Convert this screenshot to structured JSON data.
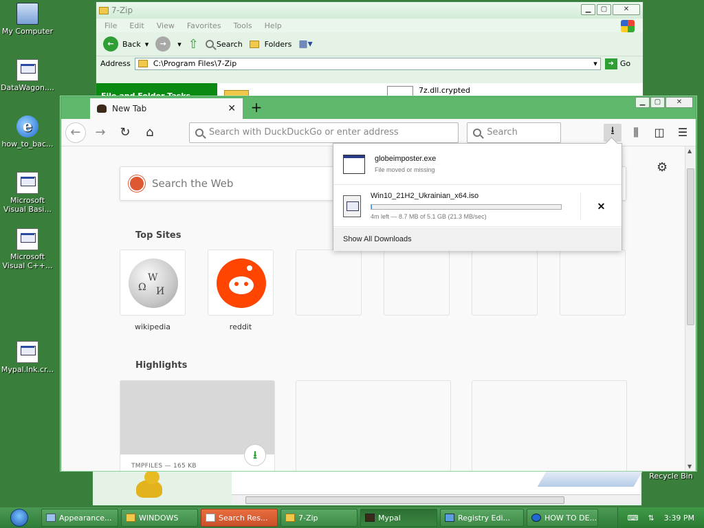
{
  "desktop": {
    "icons": [
      {
        "label": "My Computer"
      },
      {
        "label": "DataWagon...."
      },
      {
        "label": "how_to_bac..."
      },
      {
        "label": "Microsoft Visual Basi..."
      },
      {
        "label": "Microsoft Visual C++..."
      },
      {
        "label": "Mypal.lnk.cr..."
      }
    ],
    "recycle_bin": "Recycle Bin"
  },
  "explorer": {
    "title": "7-Zip",
    "menu": [
      "File",
      "Edit",
      "View",
      "Favorites",
      "Tools",
      "Help"
    ],
    "toolbar": {
      "back": "Back",
      "search": "Search",
      "folders": "Folders"
    },
    "address_label": "Address",
    "address_value": "C:\\Program Files\\7-Zip",
    "go": "Go",
    "tasks_title": "File and Folder Tasks",
    "file_name": "7z.dll.crypted"
  },
  "browser": {
    "tab_title": "New Tab",
    "url_placeholder": "Search with DuckDuckGo or enter address",
    "search_placeholder": "Search",
    "web_search_placeholder": "Search the Web",
    "top_sites_title": "Top Sites",
    "top_sites": [
      {
        "label": "wikipedia"
      },
      {
        "label": "reddit"
      }
    ],
    "highlights_title": "Highlights",
    "highlight_meta": "TMPFILES — 165 KB"
  },
  "downloads": {
    "items": [
      {
        "name": "globeimposter.exe",
        "status": "File moved or missing"
      },
      {
        "name": "Win10_21H2_Ukrainian_x64.iso",
        "status": "4m left — 8.7 MB of 5.1 GB (21.3 MB/sec)",
        "progress": 0.002
      }
    ],
    "show_all": "Show All Downloads"
  },
  "taskbar": {
    "buttons": [
      "Appearance...",
      "WINDOWS",
      "Search Res...",
      "7-Zip",
      "Mypal",
      "Registry Edi...",
      "HOW TO DE..."
    ],
    "clock": "3:39 PM"
  }
}
